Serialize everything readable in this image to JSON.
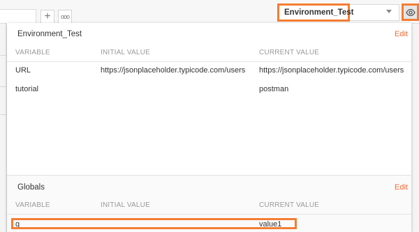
{
  "colors": {
    "accent_orange": "#f47d31",
    "edit_link": "#f26b3a",
    "header_gray": "#999999",
    "text": "#333333"
  },
  "toolbar": {
    "add_tab_glyph": "+",
    "more_glyph": "ooo",
    "environment_selected": "Environment_Test",
    "environment_quicklook_icon": "eye-icon"
  },
  "environment": {
    "name": "Environment_Test",
    "edit_label": "Edit",
    "columns": [
      "VARIABLE",
      "INITIAL VALUE",
      "CURRENT VALUE"
    ],
    "rows": [
      {
        "variable": "URL",
        "initial": "https://jsonplaceholder.typicode.com/users",
        "current": "https://jsonplaceholder.typicode.com/users"
      },
      {
        "variable": "tutorial",
        "initial": "",
        "current": "postman"
      }
    ]
  },
  "globals": {
    "name": "Globals",
    "edit_label": "Edit",
    "columns": [
      "VARIABLE",
      "INITIAL VALUE",
      "CURRENT VALUE"
    ],
    "rows": [
      {
        "variable": "g",
        "initial": "",
        "current": "value1"
      }
    ]
  }
}
